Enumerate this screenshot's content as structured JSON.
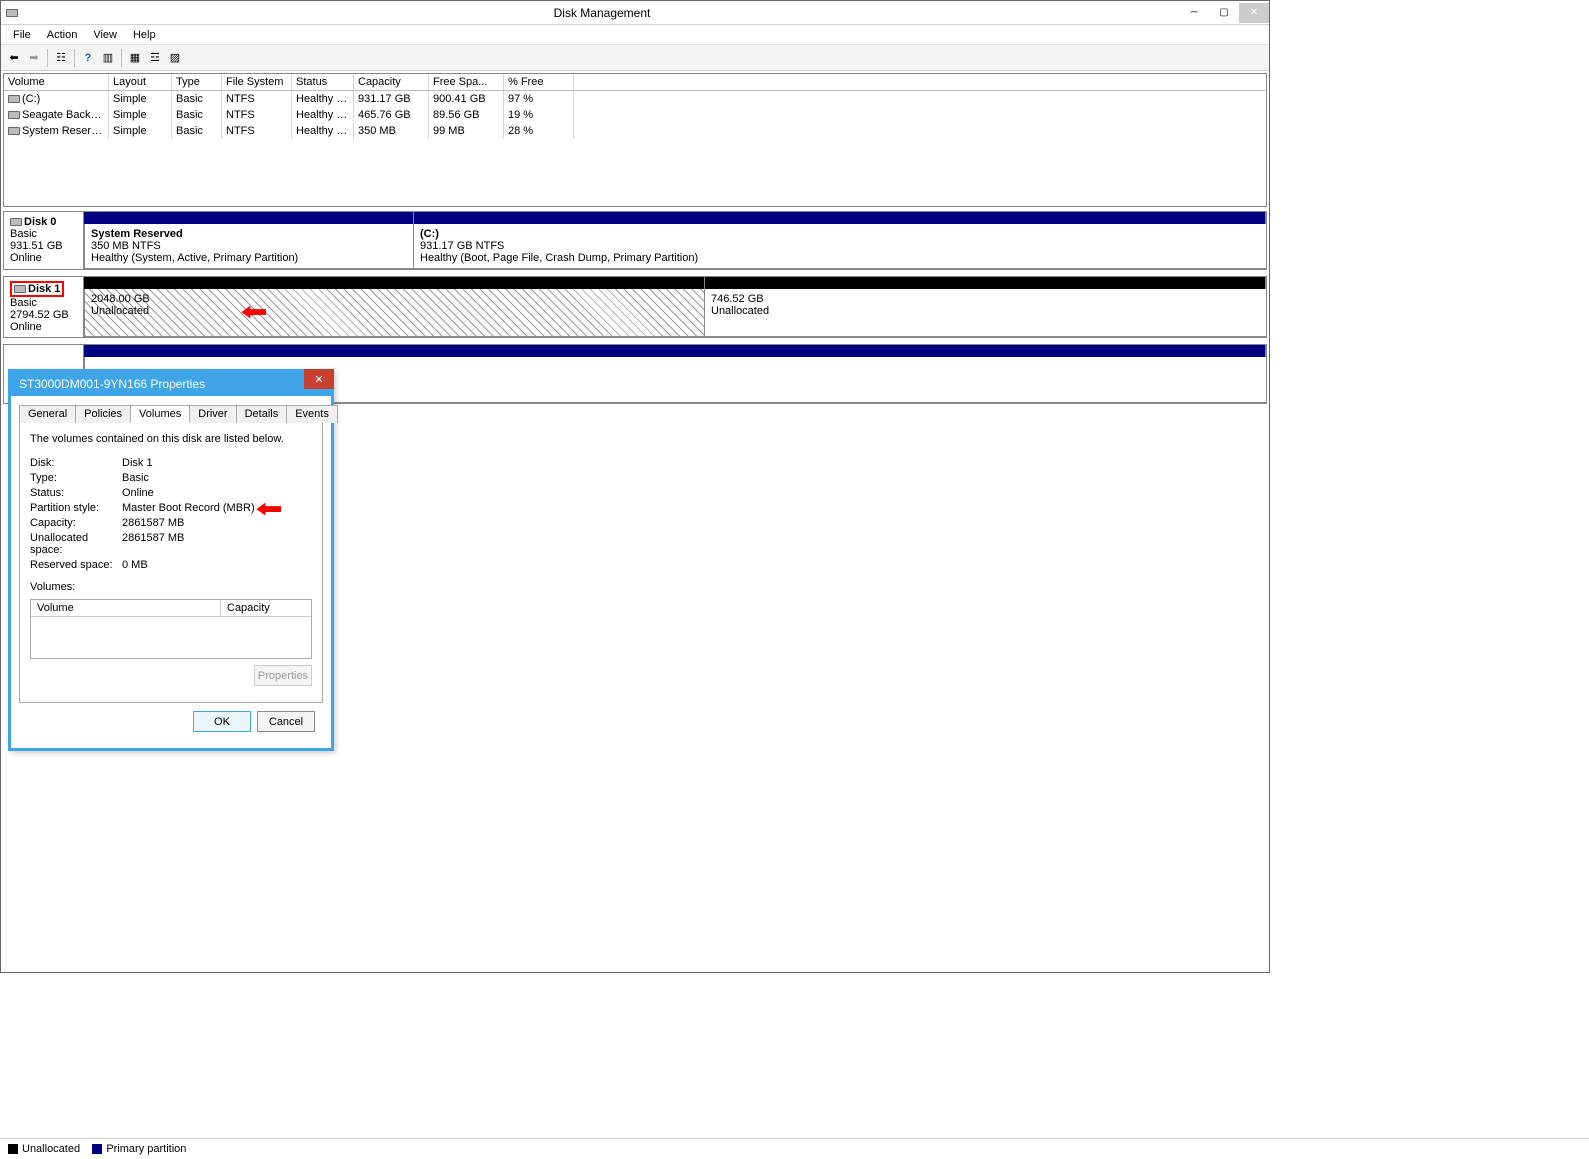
{
  "window": {
    "title": "Disk Management"
  },
  "menu": {
    "file": "File",
    "action": "Action",
    "view": "View",
    "help": "Help"
  },
  "columns": {
    "volume": "Volume",
    "layout": "Layout",
    "type": "Type",
    "fs": "File System",
    "status": "Status",
    "capacity": "Capacity",
    "free": "Free Spa...",
    "pfree": "% Free"
  },
  "volumes": [
    {
      "name": "(C:)",
      "layout": "Simple",
      "type": "Basic",
      "fs": "NTFS",
      "status": "Healthy (B...",
      "cap": "931.17 GB",
      "free": "900.41 GB",
      "pf": "97 %"
    },
    {
      "name": "Seagate Backup Pl...",
      "layout": "Simple",
      "type": "Basic",
      "fs": "NTFS",
      "status": "Healthy (P...",
      "cap": "465.76 GB",
      "free": "89.56 GB",
      "pf": "19 %"
    },
    {
      "name": "System Reserved",
      "layout": "Simple",
      "type": "Basic",
      "fs": "NTFS",
      "status": "Healthy (S...",
      "cap": "350 MB",
      "free": "99 MB",
      "pf": "28 %"
    }
  ],
  "disk0": {
    "label": "Disk 0",
    "type": "Basic",
    "size": "931.51 GB",
    "status": "Online",
    "p1": {
      "title": "System Reserved",
      "sub": "350 MB NTFS",
      "stat": "Healthy (System, Active, Primary Partition)"
    },
    "p2": {
      "title": "(C:)",
      "sub": "931.17 GB NTFS",
      "stat": "Healthy (Boot, Page File, Crash Dump, Primary Partition)"
    }
  },
  "disk1": {
    "label": "Disk 1",
    "type": "Basic",
    "size": "2794.52 GB",
    "status": "Online",
    "p1": {
      "size": "2048.00 GB",
      "stat": "Unallocated"
    },
    "p2": {
      "size": "746.52 GB",
      "stat": "Unallocated"
    }
  },
  "legend": {
    "unalloc": "Unallocated",
    "primary": "Primary partition"
  },
  "dialog": {
    "title": "ST3000DM001-9YN166 Properties",
    "tabs": {
      "general": "General",
      "policies": "Policies",
      "volumes": "Volumes",
      "driver": "Driver",
      "details": "Details",
      "events": "Events"
    },
    "intro": "The volumes contained on this disk are listed below.",
    "props": {
      "disk_l": "Disk:",
      "disk_v": "Disk 1",
      "type_l": "Type:",
      "type_v": "Basic",
      "status_l": "Status:",
      "status_v": "Online",
      "ps_l": "Partition style:",
      "ps_v": "Master Boot Record (MBR)",
      "cap_l": "Capacity:",
      "cap_v": "2861587 MB",
      "un_l": "Unallocated space:",
      "un_v": "2861587 MB",
      "res_l": "Reserved space:",
      "res_v": "0 MB"
    },
    "vols_label": "Volumes:",
    "vols_cols": {
      "v": "Volume",
      "c": "Capacity"
    },
    "props_btn": "Properties",
    "ok": "OK",
    "cancel": "Cancel"
  }
}
